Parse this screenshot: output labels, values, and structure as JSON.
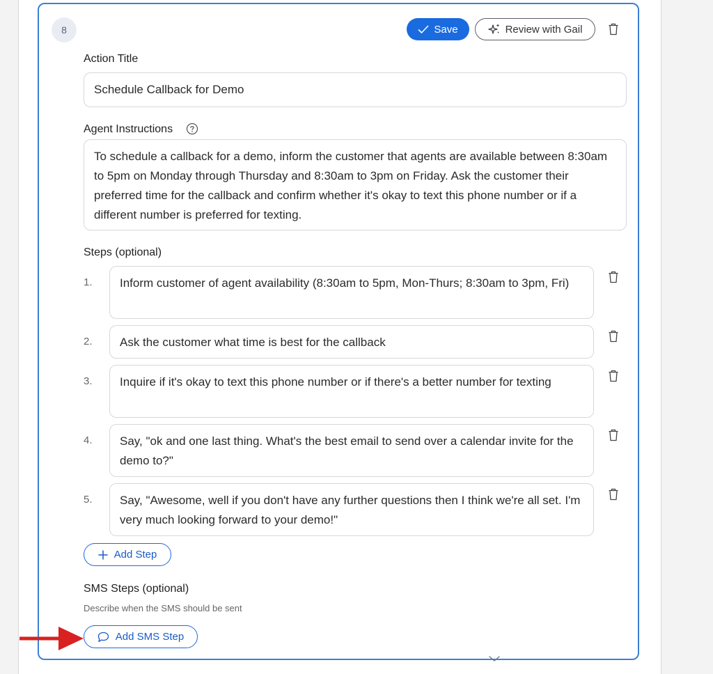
{
  "card": {
    "number": "8",
    "save_label": "Save",
    "review_label": "Review with Gail"
  },
  "action_title": {
    "label": "Action Title",
    "value": "Schedule Callback for Demo"
  },
  "agent_instructions": {
    "label": "Agent Instructions",
    "value": "To schedule a callback for a demo, inform the customer that agents are available between 8:30am to 5pm on Monday through Thursday and 8:30am to 3pm on Friday. Ask the customer their preferred time for the callback and confirm whether it's okay to text this phone number or if a different number is preferred for texting."
  },
  "steps": {
    "label": "Steps (optional)",
    "items": [
      {
        "num": "1.",
        "text": "Inform customer of agent availability (8:30am to 5pm, Mon-Thurs; 8:30am to 3pm, Fri)"
      },
      {
        "num": "2.",
        "text": "Ask the customer what time is best for the callback"
      },
      {
        "num": "3.",
        "text": "Inquire if it's okay to text this phone number or if there's a better number for texting"
      },
      {
        "num": "4.",
        "text": "Say, \"ok and one last thing. What's the best email to send over a calendar invite for the demo to?\""
      },
      {
        "num": "5.",
        "text": "Say, \"Awesome, well if you don't have any further questions then I think we're all set. I'm very much looking forward to your demo!\""
      }
    ],
    "add_label": "Add Step"
  },
  "sms": {
    "label": "SMS Steps (optional)",
    "description": "Describe when the SMS should be sent",
    "add_label": "Add SMS Step"
  },
  "colors": {
    "accent": "#1a6be0",
    "card_border": "#3a7fd6",
    "annotation_arrow": "#d92121"
  }
}
